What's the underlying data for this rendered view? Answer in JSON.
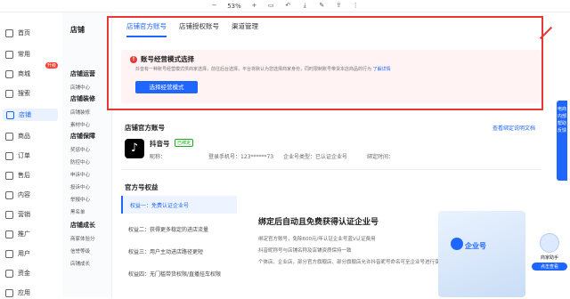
{
  "toolbar": {
    "zoom": "53%"
  },
  "sidebar": {
    "items": [
      {
        "label": "首页",
        "icon": "home-icon"
      },
      {
        "label": "常用",
        "icon": "star-icon"
      },
      {
        "label": "商城",
        "icon": "shop-icon"
      },
      {
        "label": "搜索",
        "icon": "search-icon"
      },
      {
        "label": "店铺",
        "icon": "store-icon"
      },
      {
        "label": "商品",
        "icon": "goods-icon"
      },
      {
        "label": "订单",
        "icon": "order-icon"
      },
      {
        "label": "售后",
        "icon": "service-icon"
      },
      {
        "label": "内容",
        "icon": "content-icon"
      },
      {
        "label": "营销",
        "icon": "marketing-icon"
      },
      {
        "label": "推广",
        "icon": "promote-icon"
      },
      {
        "label": "用户",
        "icon": "user-icon"
      },
      {
        "label": "资金",
        "icon": "funds-icon"
      },
      {
        "label": "应用",
        "icon": "apps-icon"
      }
    ],
    "badge": "升级"
  },
  "subnav": {
    "title": "店铺",
    "groups": [
      {
        "label": "店铺运营"
      },
      {
        "label": "店铺装修"
      },
      {
        "label": "店铺保障"
      },
      {
        "label": "店铺成长"
      }
    ],
    "items": [
      "店铺中心",
      "店铺装修",
      "素材中心",
      "奖惩中心",
      "防控中心",
      "申诉中心",
      "投诉中心",
      "举报中心",
      "黑名单",
      "商家体验分",
      "信誉等级",
      "店铺成长"
    ]
  },
  "tabs": [
    "店铺官方账号",
    "店铺授权账号",
    "渠道管理"
  ],
  "card": {
    "title": "账号经营模式选择",
    "desc": "抖音有一种账号经营模式供商家选择，前往后台选择，平台将默认为您选择商家身份，同时限制账号带货本店商品的行为",
    "desc_link": "了解详情",
    "button": "选择经营模式"
  },
  "official": {
    "section": "店铺官方账号",
    "link": "查看绑定说明文档",
    "account_name": "抖音号",
    "verified": "已绑定",
    "nickname_label": "昵称：",
    "phone_label": "登录手机号：123******73",
    "type_label": "企业号类型：已认证企业号",
    "bind_time_label": "绑定时间："
  },
  "rights": {
    "section": "官方号权益",
    "items": [
      "权益一：免费认证企业号",
      "权益二：获得更多稳定的进店流量",
      "权益三：用户主动进店路径更短",
      "权益四：无门槛带货权限/直播挂车权限"
    ]
  },
  "benefit": {
    "title": "绑定后自动且免费获得认证企业号",
    "bullets": [
      "绑定官方账号，免除600元/年认证企业号蓝V认证费用",
      "抖音昵称号与店铺名称及店铺资质保持一致",
      "个体店、企业店，部分官方旗舰店、部分旗舰店允许抖音昵号命名可至企业号进行变更，变更需符合命名规范"
    ],
    "promo_text": "企业号"
  },
  "side_tab": "电商内部帮助反馈",
  "helper": {
    "label1": "商家助手",
    "label2": "点击查看"
  }
}
